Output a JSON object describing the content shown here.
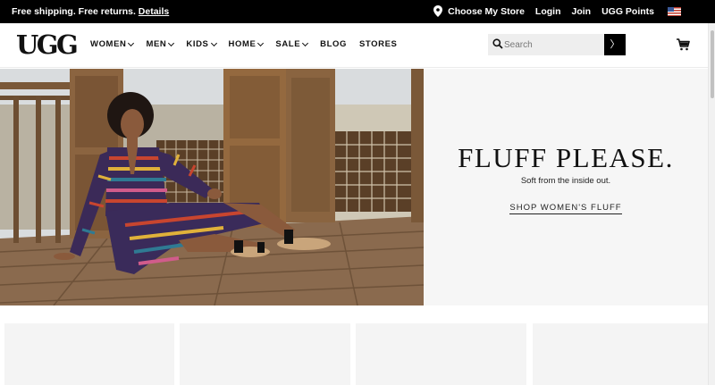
{
  "promo": {
    "text": "Free shipping. Free returns.",
    "details_link": "Details",
    "store_label": "Choose My Store",
    "login_label": "Login",
    "join_label": "Join",
    "points_label": "UGG Points",
    "flag_icon": "us-flag-icon",
    "pin_icon": "location-pin-icon"
  },
  "header": {
    "logo_text": "UGG",
    "nav": [
      {
        "label": "WOMEN",
        "has_dropdown": true
      },
      {
        "label": "MEN",
        "has_dropdown": true
      },
      {
        "label": "KIDS",
        "has_dropdown": true
      },
      {
        "label": "HOME",
        "has_dropdown": true
      },
      {
        "label": "SALE",
        "has_dropdown": true
      },
      {
        "label": "BLOG",
        "has_dropdown": false
      },
      {
        "label": "STORES",
        "has_dropdown": false
      }
    ],
    "search": {
      "placeholder": "Search",
      "value": "",
      "button_glyph": "〉"
    },
    "cart_icon": "shopping-cart-icon"
  },
  "hero": {
    "title": "FLUFF PLEASE.",
    "subtitle": "Soft from the inside out.",
    "cta": "SHOP WOMEN'S FLUFF"
  },
  "colors": {
    "promo_bg": "#000000",
    "panel_bg": "#f6f6f6",
    "tile_bg": "#f4f4f4",
    "search_bg": "#eeeeee"
  }
}
